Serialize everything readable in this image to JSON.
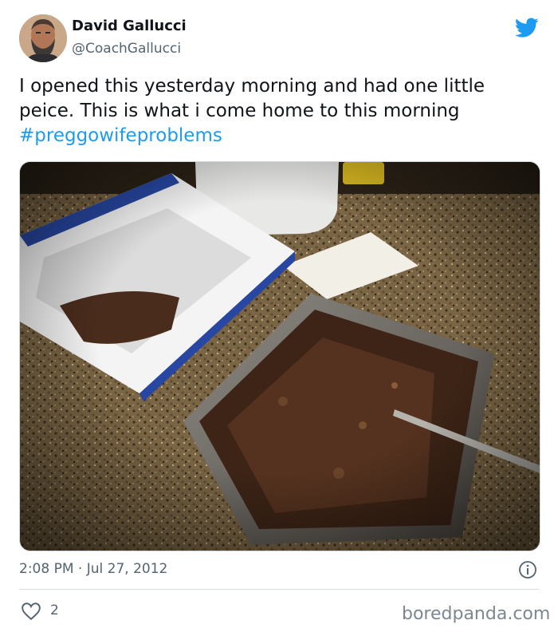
{
  "author": {
    "name": "David Gallucci",
    "handle": "@CoachGallucci"
  },
  "tweet": {
    "text_main": "I opened this yesterday morning and had one little peice. This is what i come home to this morning ",
    "hashtag": "#preggowifeproblems",
    "timestamp": "2:08 PM · Jul 27, 2012",
    "like_count": "2"
  },
  "watermark": "boredpanda.com",
  "colors": {
    "accent": "#1d9bf0",
    "secondary_text": "#536471"
  },
  "icons": [
    "twitter-bird-icon",
    "info-icon",
    "heart-icon"
  ]
}
